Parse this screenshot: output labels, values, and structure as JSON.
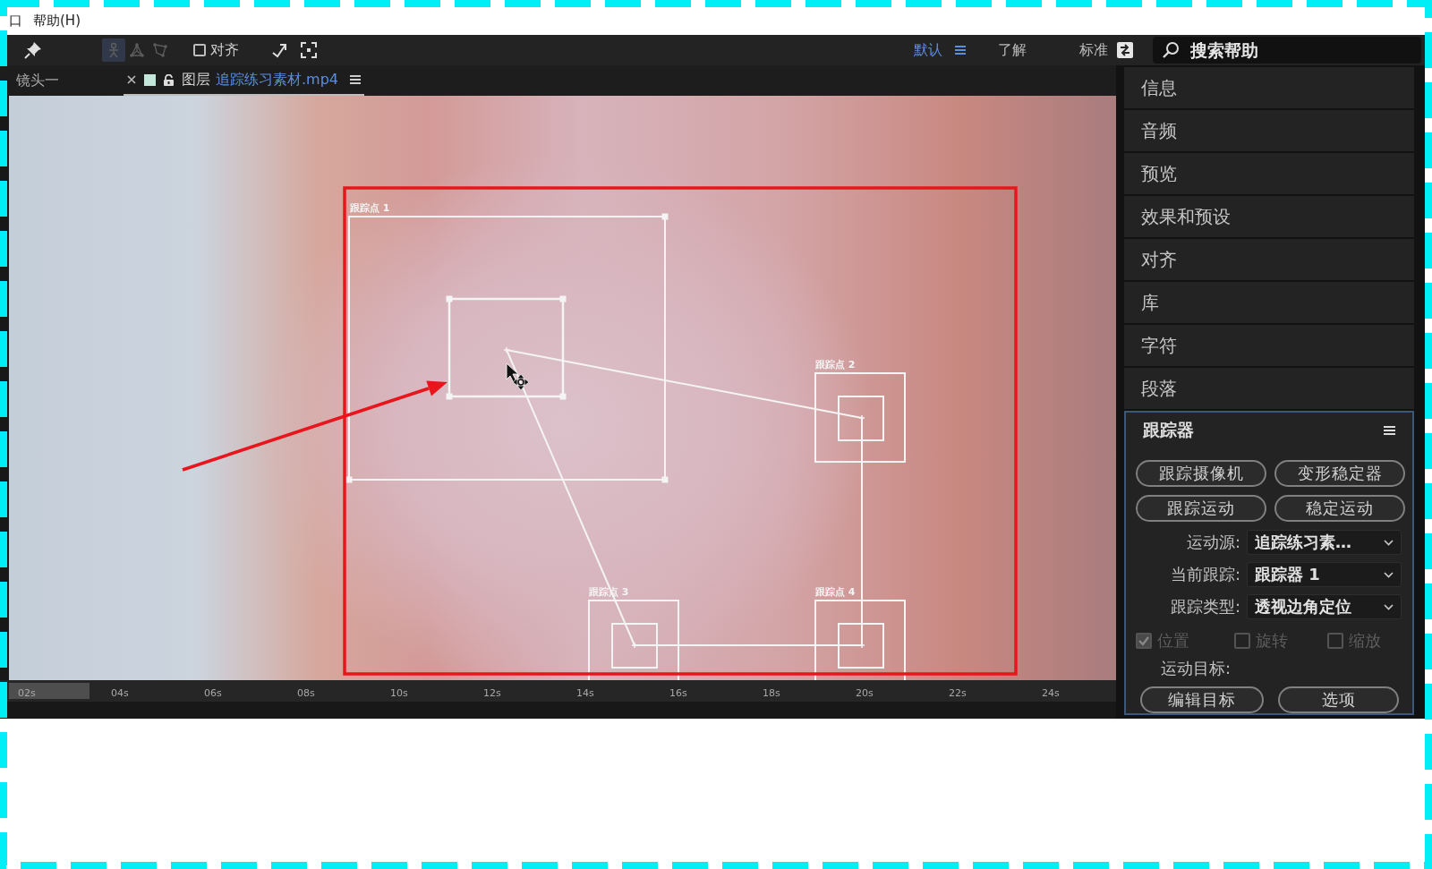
{
  "menu_bar": {
    "items": [
      "口",
      "帮助(H)"
    ]
  },
  "toolbar": {
    "tools": [
      {
        "kind": "pin",
        "selected": false,
        "disabled": false
      },
      {
        "kind": "figure",
        "selected": true,
        "disabled": true
      },
      {
        "kind": "triangle",
        "selected": false,
        "disabled": true
      },
      {
        "kind": "quad",
        "selected": false,
        "disabled": true
      }
    ],
    "snapping": {
      "label": "对齐",
      "checked": false
    },
    "workspaces": [
      {
        "label": "默认",
        "selected": true
      },
      {
        "label": "了解",
        "selected": false
      },
      {
        "label": "标准",
        "selected": false
      }
    ],
    "search": {
      "placeholder": "搜索帮助"
    }
  },
  "tabs": [
    {
      "label": "镜头一",
      "selected": false
    },
    {
      "label": "图层",
      "source": "追踪练习素材.mp4",
      "selected": true
    }
  ],
  "viewer": {
    "track_points": [
      {
        "label": "跟踪点 1",
        "selected": true
      },
      {
        "label": "跟踪点 2",
        "selected": false
      },
      {
        "label": "跟踪点 3",
        "selected": false
      },
      {
        "label": "跟踪点 4",
        "selected": false
      }
    ]
  },
  "time_ruler": {
    "ticks": [
      "02s",
      "04s",
      "06s",
      "08s",
      "10s",
      "12s",
      "14s",
      "16s",
      "18s",
      "20s",
      "22s",
      "24s"
    ]
  },
  "panels": [
    "信息",
    "音频",
    "预览",
    "效果和预设",
    "对齐",
    "库",
    "字符",
    "段落"
  ],
  "tracker": {
    "title": "跟踪器",
    "buttons": [
      "跟踪摄像机",
      "变形稳定器",
      "跟踪运动",
      "稳定运动"
    ],
    "fields": [
      {
        "label": "运动源:",
        "value": "追踪练习素…"
      },
      {
        "label": "当前跟踪:",
        "value": "跟踪器 1"
      },
      {
        "label": "跟踪类型:",
        "value": "透视边角定位"
      }
    ],
    "options": [
      {
        "label": "位置",
        "checked": true,
        "disabled": true
      },
      {
        "label": "旋转",
        "checked": false,
        "disabled": true
      },
      {
        "label": "缩放",
        "checked": false,
        "disabled": true
      }
    ],
    "target_label": "运动目标:",
    "target_buttons": [
      "编辑目标",
      "选项"
    ]
  }
}
